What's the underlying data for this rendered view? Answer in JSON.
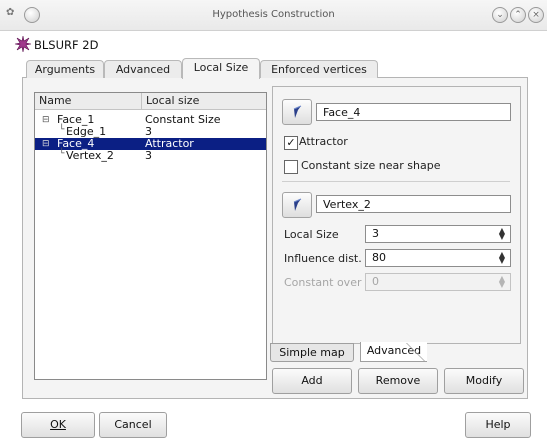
{
  "window": {
    "title": "Hypothesis Construction"
  },
  "header": {
    "text": "BLSURF 2D"
  },
  "tabs": [
    "Arguments",
    "Advanced",
    "Local Size",
    "Enforced vertices"
  ],
  "tree": {
    "headers": [
      "Name",
      "Local size"
    ],
    "rows": [
      {
        "name": "Face_1",
        "value": "Constant Size"
      },
      {
        "name": "Edge_1",
        "value": "3"
      },
      {
        "name": "Face_4",
        "value": "Attractor"
      },
      {
        "name": "Vertex_2",
        "value": "3"
      }
    ]
  },
  "form": {
    "face_field": "Face_4",
    "attractor_label": "Attractor",
    "attractor_checked": true,
    "constant_size_label": "Constant size near shape",
    "constant_size_checked": false,
    "vertex_field": "Vertex_2",
    "local_size_label": "Local Size",
    "local_size_value": "3",
    "influence_label": "Influence dist.",
    "influence_value": "80",
    "constant_over_label": "Constant over",
    "constant_over_value": "0"
  },
  "subtabs": [
    "Simple map",
    "Advanced"
  ],
  "actions": {
    "add": "Add",
    "remove": "Remove",
    "modify": "Modify"
  },
  "footer": {
    "ok": "OK",
    "cancel": "Cancel",
    "help": "Help"
  }
}
